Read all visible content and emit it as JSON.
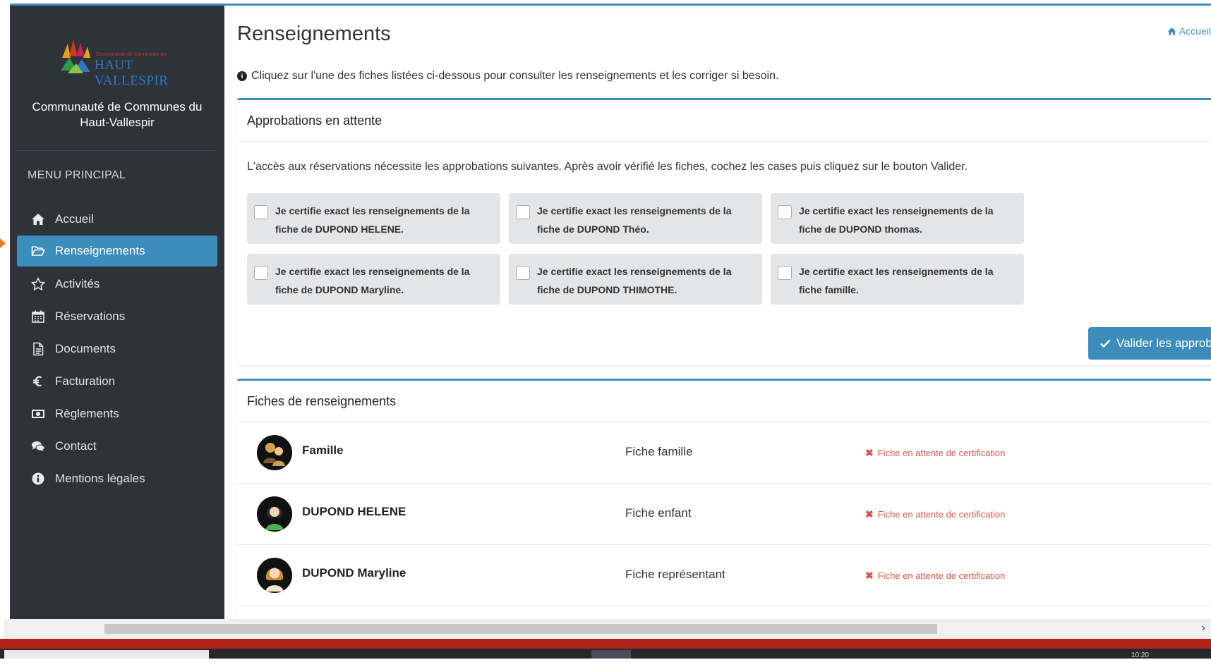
{
  "sidebar": {
    "logo_small_text": "Communauté de Communes du",
    "logo_text": "HAUT VALLESPIR",
    "organization": "Communauté de Communes du Haut-Vallespir",
    "menu_title": "MENU PRINCIPAL",
    "items": [
      {
        "label": "Accueil",
        "icon": "home-icon"
      },
      {
        "label": "Renseignements",
        "icon": "folder-open-icon",
        "active": true
      },
      {
        "label": "Activités",
        "icon": "star-icon"
      },
      {
        "label": "Réservations",
        "icon": "calendar-icon"
      },
      {
        "label": "Documents",
        "icon": "file-icon"
      },
      {
        "label": "Facturation",
        "icon": "euro-icon"
      },
      {
        "label": "Règlements",
        "icon": "money-icon"
      },
      {
        "label": "Contact",
        "icon": "comments-icon"
      },
      {
        "label": "Mentions légales",
        "icon": "info-circle-icon"
      }
    ]
  },
  "header": {
    "title": "Renseignements",
    "breadcrumb": "Accueil",
    "info": "Cliquez sur l'une des fiches listées ci-dessous pour consulter les renseignements et les corriger si besoin."
  },
  "approvals": {
    "title": "Approbations en attente",
    "description": "L'accès aux réservations nécessite les approbations suivantes. Après avoir vérifié les fiches, cochez les cases puis cliquez sur le bouton Valider.",
    "items": [
      {
        "text": "Je certifie exact les renseignements de la fiche de DUPOND HELENE."
      },
      {
        "text": "Je certifie exact les renseignements de la fiche de DUPOND Théo."
      },
      {
        "text": "Je certifie exact les renseignements de la fiche de DUPOND thomas."
      },
      {
        "text": "Je certifie exact les renseignements de la fiche de DUPOND Maryline."
      },
      {
        "text": "Je certifie exact les renseignements de la fiche de DUPOND THIMOTHE."
      },
      {
        "text": "Je certifie exact les renseignements de la fiche famille."
      }
    ],
    "validate_button": "Valider les approbat"
  },
  "fiches": {
    "title": "Fiches de renseignements",
    "rows": [
      {
        "name": "Famille",
        "type": "Fiche famille",
        "status": "Fiche en attente de certification"
      },
      {
        "name": "DUPOND HELENE",
        "type": "Fiche enfant",
        "status": "Fiche en attente de certification"
      },
      {
        "name": "DUPOND Maryline",
        "type": "Fiche représentant",
        "status": "Fiche en attente de certification"
      }
    ]
  },
  "taskbar": {
    "clock": "10:20"
  },
  "colors": {
    "accent": "#3c8dbc",
    "sidebar": "#2d3339",
    "status_error": "#d9534f",
    "taskbar": "#b0241b"
  }
}
